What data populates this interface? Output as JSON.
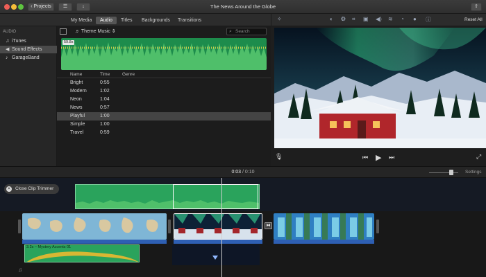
{
  "window": {
    "title": "The News Around the Globe",
    "projects_label": "Projects"
  },
  "browser_tabs": [
    {
      "label": "My Media",
      "active": false
    },
    {
      "label": "Audio",
      "active": true
    },
    {
      "label": "Titles",
      "active": false
    },
    {
      "label": "Backgrounds",
      "active": false
    },
    {
      "label": "Transitions",
      "active": false
    }
  ],
  "sidebar": {
    "heading": "AUDIO",
    "items": [
      {
        "label": "iTunes",
        "icon": "music-note-icon",
        "selected": false
      },
      {
        "label": "Sound Effects",
        "icon": "speaker-icon",
        "selected": true
      },
      {
        "label": "GarageBand",
        "icon": "guitar-icon",
        "selected": false
      }
    ]
  },
  "audio_browser": {
    "dropdown": "Theme Music",
    "search_placeholder": "Search",
    "preview_duration": "59.8s",
    "columns": {
      "name": "Name",
      "time": "Time",
      "genre": "Genre"
    },
    "rows": [
      {
        "name": "Bright",
        "time": "0:55",
        "selected": false
      },
      {
        "name": "Modern",
        "time": "1:02",
        "selected": false
      },
      {
        "name": "Neon",
        "time": "1:04",
        "selected": false
      },
      {
        "name": "News",
        "time": "0:57",
        "selected": false
      },
      {
        "name": "Playful",
        "time": "1:00",
        "selected": true
      },
      {
        "name": "Simple",
        "time": "1:00",
        "selected": false
      },
      {
        "name": "Travel",
        "time": "0:59",
        "selected": false
      }
    ]
  },
  "viewer": {
    "reset_label": "Reset All",
    "tool_icons": [
      "magic-wand-icon",
      "color-balance-icon",
      "color-correction-icon",
      "crop-icon",
      "stabilization-icon",
      "volume-icon",
      "noise-reduction-icon",
      "speed-icon",
      "filter-icon",
      "info-icon"
    ]
  },
  "timeline": {
    "current_time": "0:03",
    "total_time": "0:10",
    "separator": "/",
    "settings_label": "Settings",
    "close_trimmer_label": "Close Clip Trimmer",
    "audio_clip_label": "3.2s – Mystery Accents 01"
  },
  "colors": {
    "audio_green": "#2aa35c",
    "selection_blue": "#2e5fb3",
    "accent_red": "#ee5e57"
  }
}
